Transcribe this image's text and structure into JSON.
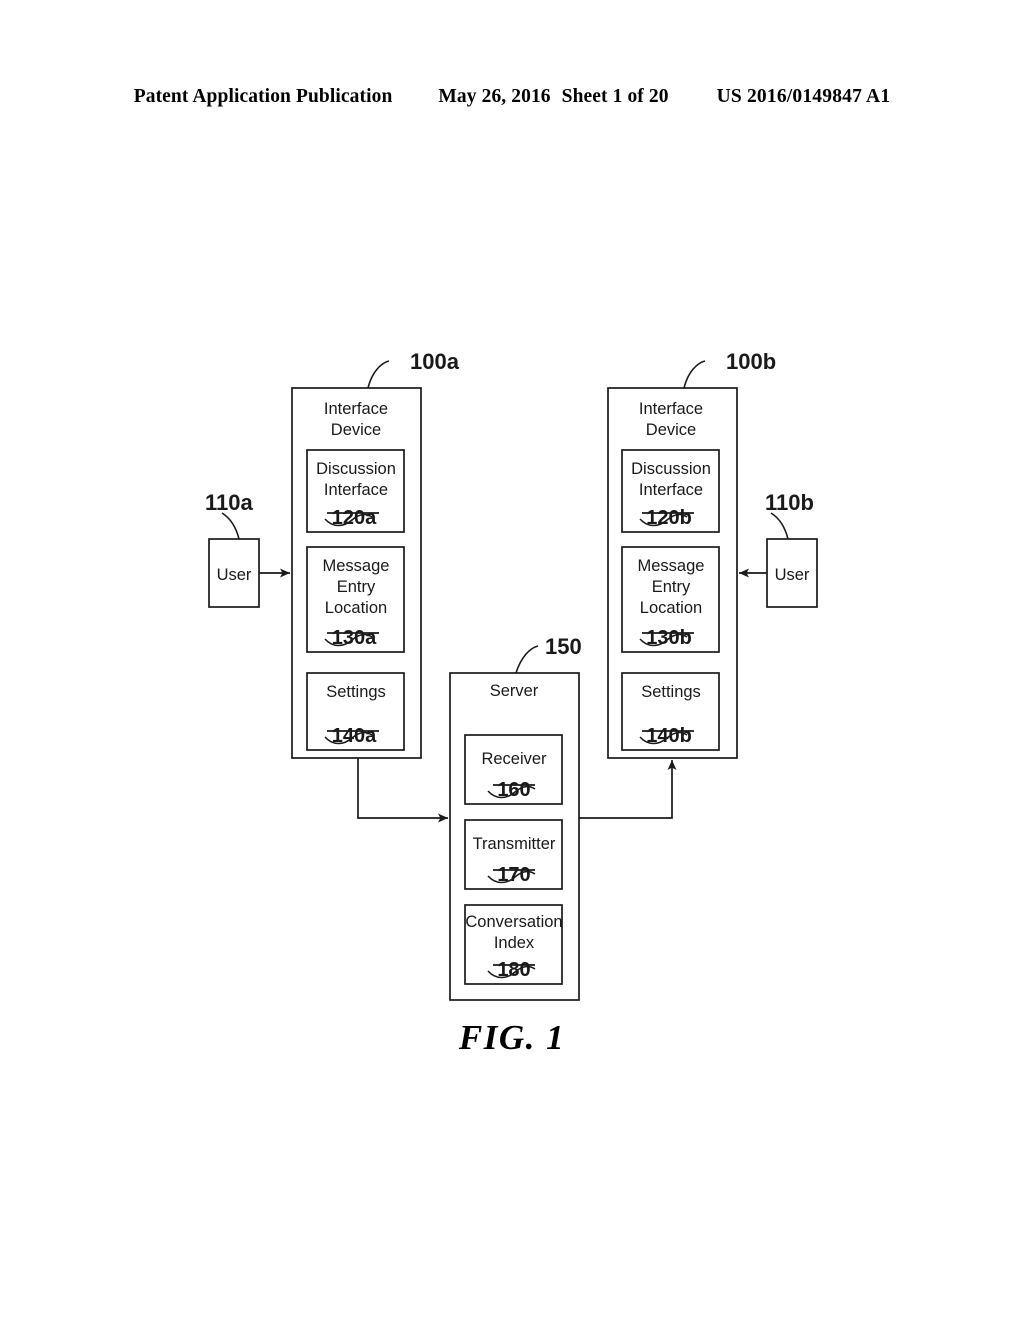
{
  "header": {
    "publication": "Patent Application Publication",
    "date": "May 26, 2016",
    "sheet": "Sheet 1 of 20",
    "patent_number": "US 2016/0149847 A1"
  },
  "figure": {
    "caption": "FIG. 1",
    "devices": [
      {
        "id": "device-a",
        "ref": "100a",
        "title_line1": "Interface",
        "title_line2": "Device",
        "modules": [
          {
            "id": "discussion-interface-a",
            "lines": [
              "Discussion",
              "Interface"
            ],
            "ref": "120a"
          },
          {
            "id": "message-entry-location-a",
            "lines": [
              "Message",
              "Entry",
              "Location"
            ],
            "ref": "130a"
          },
          {
            "id": "settings-a",
            "lines": [
              "Settings"
            ],
            "ref": "140a"
          }
        ]
      },
      {
        "id": "device-b",
        "ref": "100b",
        "title_line1": "Interface",
        "title_line2": "Device",
        "modules": [
          {
            "id": "discussion-interface-b",
            "lines": [
              "Discussion",
              "Interface"
            ],
            "ref": "120b"
          },
          {
            "id": "message-entry-location-b",
            "lines": [
              "Message",
              "Entry",
              "Location"
            ],
            "ref": "130b"
          },
          {
            "id": "settings-b",
            "lines": [
              "Settings"
            ],
            "ref": "140b"
          }
        ]
      }
    ],
    "users": [
      {
        "id": "user-a",
        "label": "User",
        "ref": "110a"
      },
      {
        "id": "user-b",
        "label": "User",
        "ref": "110b"
      }
    ],
    "server": {
      "id": "server",
      "title": "Server",
      "ref": "150",
      "modules": [
        {
          "id": "receiver",
          "lines": [
            "Receiver"
          ],
          "ref": "160"
        },
        {
          "id": "transmitter",
          "lines": [
            "Transmitter"
          ],
          "ref": "170"
        },
        {
          "id": "conversation-index",
          "lines": [
            "Conversation",
            "Index"
          ],
          "ref": "180"
        }
      ]
    }
  },
  "style": {
    "ink": "#1a1a1a",
    "paper": "#ffffff"
  }
}
